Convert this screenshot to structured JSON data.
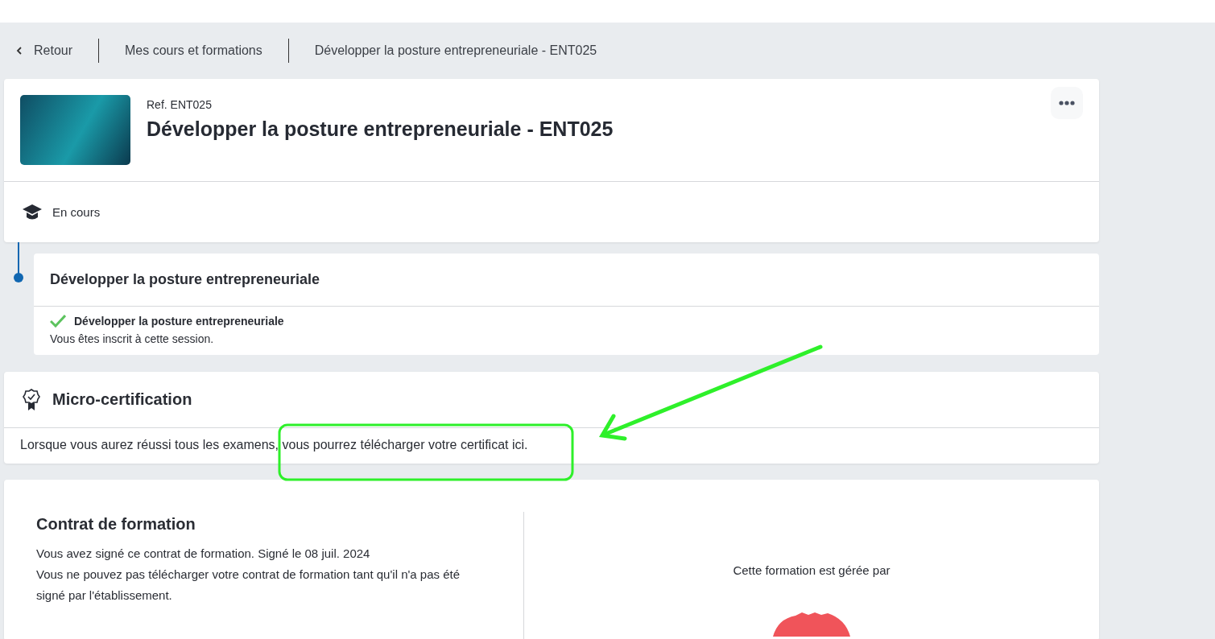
{
  "breadcrumb": {
    "back": "Retour",
    "items": [
      "Mes cours et formations",
      "Développer la posture entrepreneuriale - ENT025"
    ]
  },
  "course": {
    "ref": "Ref. ENT025",
    "title": "Développer la posture entrepreneuriale - ENT025",
    "status": "En cours"
  },
  "session": {
    "title": "Développer la posture entrepreneuriale",
    "item": {
      "label": "Développer la posture entrepreneuriale",
      "checked": true
    },
    "note": "Vous êtes inscrit à cette session."
  },
  "certification": {
    "title": "Micro-certification",
    "message": "Lorsque vous aurez réussi tous les examens, vous pourrez télécharger votre certificat ici."
  },
  "contract": {
    "title": "Contrat de formation",
    "lines": [
      "Vous avez signé ce contrat de formation. Signé le 08 juil. 2024",
      "Vous ne pouvez pas télécharger votre contrat de formation tant qu'il n'a pas été signé par l'établissement."
    ],
    "managed_by": "Cette formation est gérée par"
  }
}
